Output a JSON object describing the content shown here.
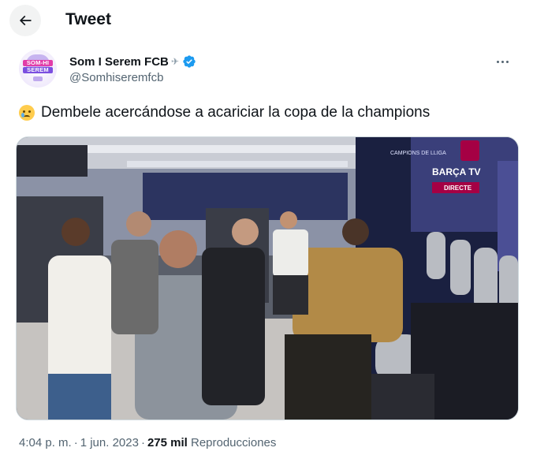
{
  "header": {
    "title": "Tweet"
  },
  "author": {
    "display_name": "Som I Serem FCB",
    "handle": "@Somhiseremfcb",
    "avatar_text_line1": "SOM-HI",
    "avatar_text_line2": "SEREM"
  },
  "tweet": {
    "emoji": "crying-face-emoji",
    "text": "Dembele acercándose a acariciar la copa de la champions"
  },
  "media": {
    "overlay_top": "CAMPIONS DE LLIGA",
    "overlay_brand": "BARÇA TV",
    "overlay_live": "DIRECTE"
  },
  "meta": {
    "time": "4:04 p. m.",
    "date": "1 jun. 2023",
    "views_count": "275 mil",
    "views_label": "Reproducciones"
  },
  "colors": {
    "text_primary": "#0f1419",
    "text_secondary": "#536471",
    "verified": "#1d9bf0",
    "border": "#cfd9de"
  }
}
